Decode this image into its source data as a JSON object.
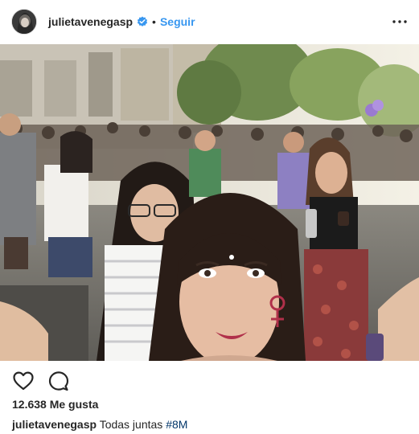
{
  "post": {
    "username": "julietavenegasp",
    "separator": "•",
    "follow_label": "Seguir",
    "likes_text": "12.638 Me gusta",
    "caption_text": "Todas juntas",
    "caption_hashtag": "#8M"
  },
  "icons": {
    "verified": "verified-badge-icon",
    "more": "more-options-icon",
    "like": "heart-icon",
    "comment": "comment-bubble-icon"
  },
  "colors": {
    "link_blue": "#3897f0",
    "hashtag_blue": "#003569",
    "text": "#262626"
  }
}
